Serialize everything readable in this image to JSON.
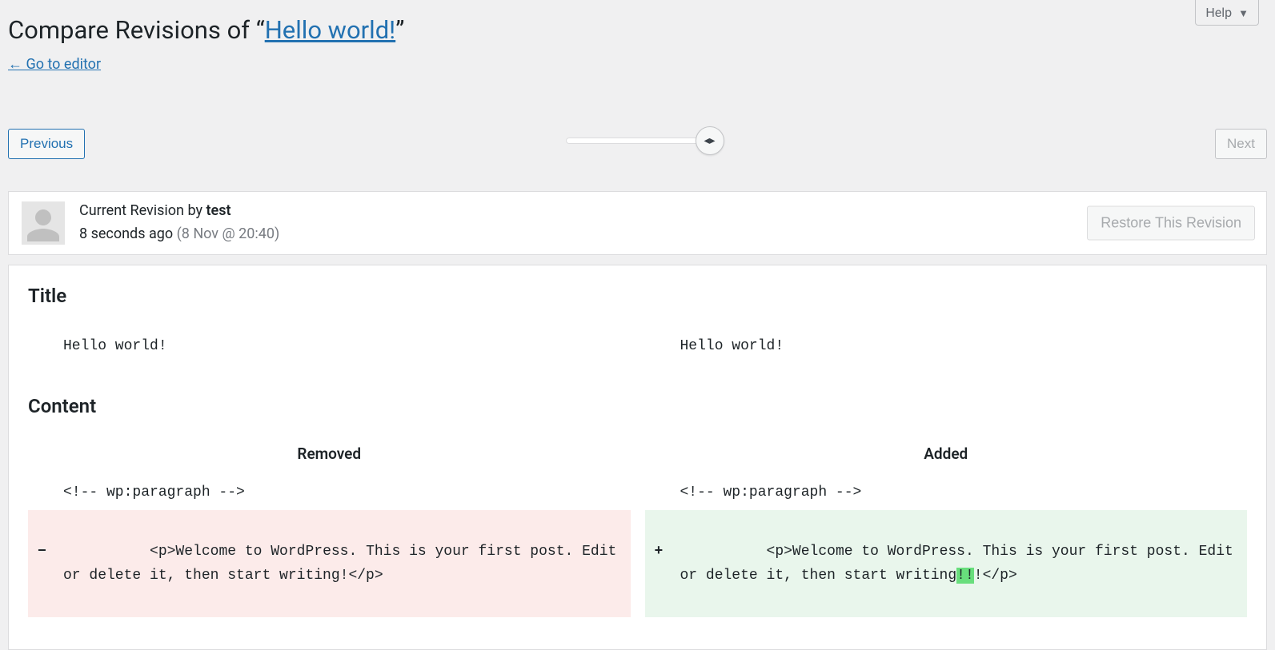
{
  "help": {
    "label": "Help"
  },
  "header": {
    "title_prefix": "Compare Revisions of “",
    "title_link": "Hello world!",
    "title_suffix": "”",
    "back_link": "← Go to editor"
  },
  "nav": {
    "previous": "Previous",
    "next": "Next"
  },
  "revision": {
    "label_prefix": "Current Revision by ",
    "author": "test",
    "ago": "8 seconds ago ",
    "date": "(8 Nov @ 20:40)",
    "restore": "Restore This Revision"
  },
  "diff": {
    "title_heading": "Title",
    "content_heading": "Content",
    "removed_label": "Removed",
    "added_label": "Added",
    "title_old": "Hello world!",
    "title_new": "Hello world!",
    "context_line": "<!-- wp:paragraph -->",
    "removed_marker": "−",
    "added_marker": "+",
    "removed_line": "<p>Welcome to WordPress. This is your first post. Edit or delete it, then start writing!</p>",
    "added_line_pre": "<p>Welcome to WordPress. This is your first post. Edit or delete it, then start writing",
    "added_line_hl": "!!",
    "added_line_post": "!</p>"
  }
}
